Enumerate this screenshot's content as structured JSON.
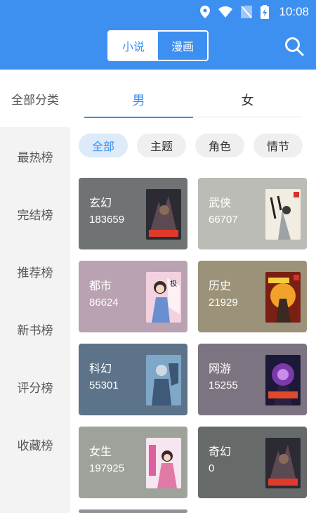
{
  "status": {
    "time": "10:08"
  },
  "header": {
    "tabs": [
      "小说",
      "漫画"
    ],
    "search_icon": "search-icon"
  },
  "sidebar": {
    "all": "全部分类",
    "items": [
      "最热榜",
      "完结榜",
      "推荐榜",
      "新书榜",
      "评分榜",
      "收藏榜"
    ]
  },
  "gender_tabs": [
    "男",
    "女"
  ],
  "chips": [
    "全部",
    "主题",
    "角色",
    "情节"
  ],
  "cards": [
    {
      "name": "玄幻",
      "count": "183659",
      "bg": "#6f7373"
    },
    {
      "name": "武侠",
      "count": "66707",
      "bg": "#bcbcb6"
    },
    {
      "name": "都市",
      "count": "86624",
      "bg": "#b9a2b2"
    },
    {
      "name": "历史",
      "count": "21929",
      "bg": "#9b9279"
    },
    {
      "name": "科幻",
      "count": "55301",
      "bg": "#5c7389"
    },
    {
      "name": "网游",
      "count": "15255",
      "bg": "#7d7481"
    },
    {
      "name": "女生",
      "count": "197925",
      "bg": "#9da39a"
    },
    {
      "name": "奇幻",
      "count": "0",
      "bg": "#666a69"
    }
  ],
  "colors": {
    "accent": "#3d8ff0",
    "header_bg": "#3d8ff0",
    "sidebar_bg": "#f3f3f3"
  }
}
